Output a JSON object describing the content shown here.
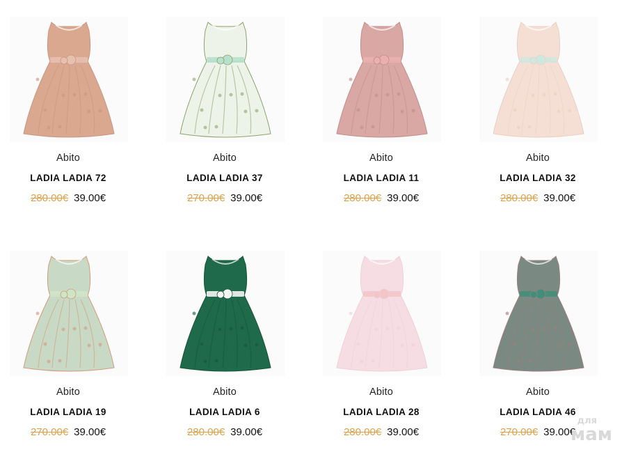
{
  "products": [
    {
      "category": "Abito",
      "name": "LADIA LADIA 72",
      "old_price": "280.00€",
      "price": "39.00€",
      "colors": {
        "dress": "#d9a88e",
        "accent": "#e8c0b0",
        "pattern": "#c99583"
      }
    },
    {
      "category": "Abito",
      "name": "LADIA LADIA 37",
      "old_price": "270.00€",
      "price": "39.00€",
      "colors": {
        "dress": "#eef3ea",
        "accent": "#b7e0cf",
        "pattern": "#8aa36a"
      }
    },
    {
      "category": "Abito",
      "name": "LADIA LADIA 11",
      "old_price": "280.00€",
      "price": "39.00€",
      "colors": {
        "dress": "#d9a8a4",
        "accent": "#eab0b0",
        "pattern": "#c48b8b"
      }
    },
    {
      "category": "Abito",
      "name": "LADIA LADIA 32",
      "old_price": "280.00€",
      "price": "39.00€",
      "colors": {
        "dress": "#f5dfd5",
        "accent": "#cfe8df",
        "pattern": "#e9cfc2"
      }
    },
    {
      "category": "Abito",
      "name": "LADIA LADIA 19",
      "old_price": "270.00€",
      "price": "39.00€",
      "colors": {
        "dress": "#c8d9c5",
        "accent": "#cfe6c6",
        "pattern": "#d49a7a"
      }
    },
    {
      "category": "Abito",
      "name": "LADIA LADIA 6",
      "old_price": "280.00€",
      "price": "39.00€",
      "colors": {
        "dress": "#1e6a4a",
        "accent": "#f4f4f4",
        "pattern": "#155539"
      }
    },
    {
      "category": "Abito",
      "name": "LADIA LADIA 28",
      "old_price": "280.00€",
      "price": "39.00€",
      "colors": {
        "dress": "#f6dde3",
        "accent": "#f3c5c8",
        "pattern": "#efd0d8"
      }
    },
    {
      "category": "Abito",
      "name": "LADIA LADIA 46",
      "old_price": "270.00€",
      "price": "39.00€",
      "colors": {
        "dress": "#7a8a82",
        "accent": "#3f8f7a",
        "pattern": "#a07c80"
      }
    }
  ],
  "watermark": {
    "small": "для",
    "big": "мам"
  }
}
